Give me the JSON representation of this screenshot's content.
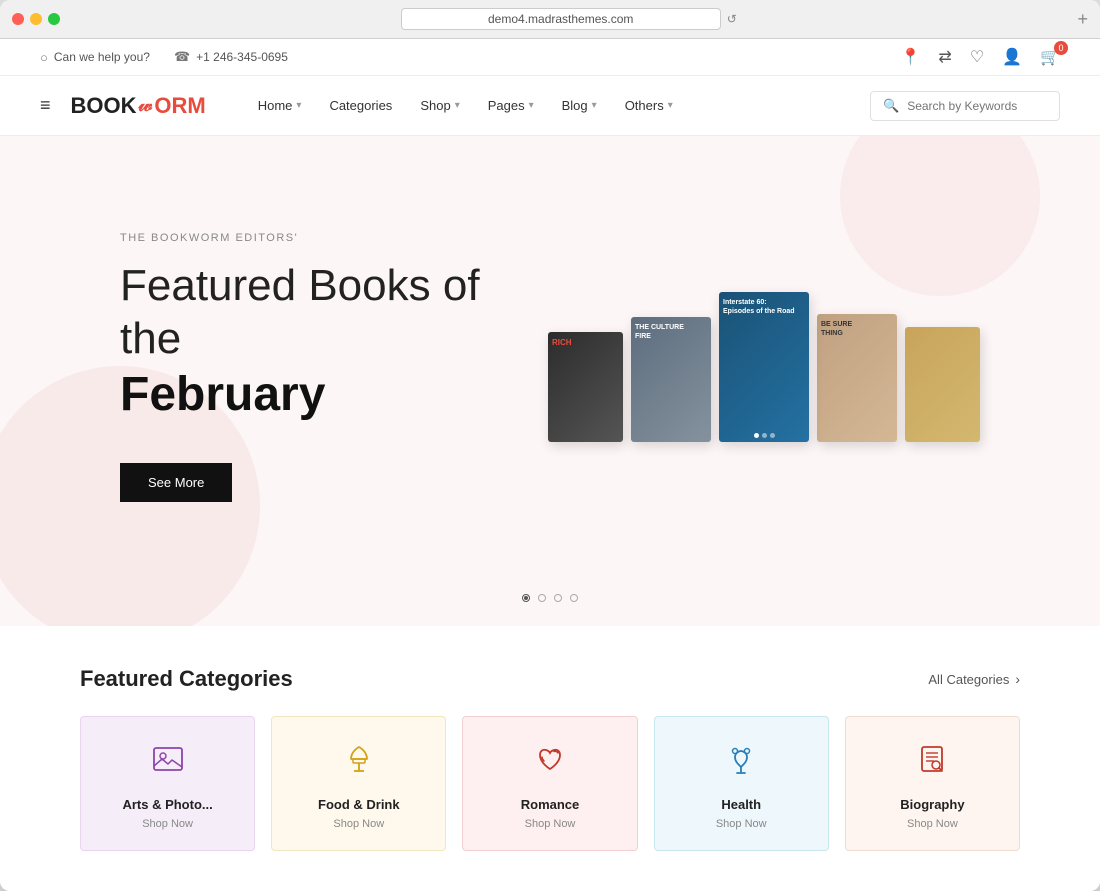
{
  "browser": {
    "dots": [
      "red",
      "yellow",
      "green"
    ],
    "url": "demo4.madrasthemes.com",
    "new_tab_label": "+"
  },
  "topbar": {
    "help_icon": "○",
    "help_text": "Can we help you?",
    "phone_icon": "☎",
    "phone_number": "+1 246-345-0695",
    "right_icons": [
      "📍",
      "⇄",
      "♡",
      "👤",
      "🛒"
    ],
    "cart_count": "0"
  },
  "nav": {
    "hamburger": "≡",
    "logo_text1": "BOOK",
    "logo_text2": "ORM",
    "items": [
      {
        "label": "Home",
        "has_chevron": true
      },
      {
        "label": "Categories",
        "has_chevron": false
      },
      {
        "label": "Shop",
        "has_chevron": true
      },
      {
        "label": "Pages",
        "has_chevron": true
      },
      {
        "label": "Blog",
        "has_chevron": true
      },
      {
        "label": "Others",
        "has_chevron": true
      }
    ],
    "search_placeholder": "Search by Keywords"
  },
  "hero": {
    "subtitle": "THE BOOKWORM EDITORS'",
    "title_line1": "Featured Books of the",
    "title_line2": "February",
    "cta_label": "See More",
    "books": [
      {
        "color_start": "#2c2c2c",
        "color_end": "#555",
        "label": "RICH"
      },
      {
        "color_start": "#c0392b",
        "color_end": "#e74c3c",
        "label": "THE CULTURE FIRE"
      },
      {
        "color_start": "#1a5276",
        "color_end": "#2980b9",
        "label": "Interstate 60: Episodes of the Road"
      },
      {
        "color_start": "#784212",
        "color_end": "#a04000",
        "label": "BE SURE THING"
      },
      {
        "color_start": "#c8a45a",
        "color_end": "#d4a857",
        "label": ""
      }
    ],
    "slider_dots": [
      {
        "active": true
      },
      {
        "active": false
      },
      {
        "active": false
      },
      {
        "active": false
      }
    ]
  },
  "categories": {
    "section_title": "Featured Categories",
    "all_link": "All Categories",
    "items": [
      {
        "name": "Arts & Photo...",
        "shop_label": "Shop Now",
        "icon": "🖼",
        "bg": "#f5eef8"
      },
      {
        "name": "Food & Drink",
        "shop_label": "Shop Now",
        "icon": "🍽",
        "bg": "#fef9ec"
      },
      {
        "name": "Romance",
        "shop_label": "Shop Now",
        "icon": "💕",
        "bg": "#fef0f0"
      },
      {
        "name": "Health",
        "shop_label": "Shop Now",
        "icon": "⚕",
        "bg": "#eef7fb"
      },
      {
        "name": "Biography",
        "shop_label": "Shop Now",
        "icon": "📋",
        "bg": "#fef5f0"
      }
    ]
  }
}
